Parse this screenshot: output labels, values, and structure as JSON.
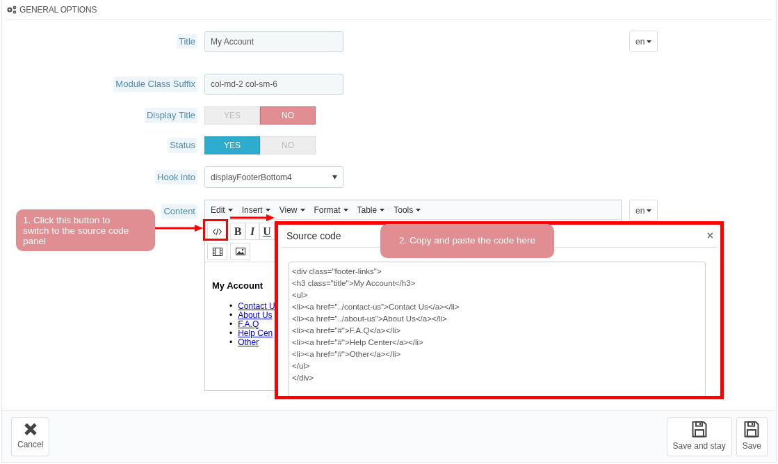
{
  "header": {
    "title": "GENERAL OPTIONS"
  },
  "fields": [
    {
      "kind": "text",
      "label": "Title",
      "value": "My Account",
      "lang": "en"
    },
    {
      "kind": "text",
      "label": "Module Class Suffix",
      "value": "col-md-2 col-sm-6"
    },
    {
      "kind": "switch",
      "label": "Display Title",
      "options": [
        {
          "label": "YES",
          "selected": false
        },
        {
          "label": "NO",
          "selected": true
        }
      ]
    },
    {
      "kind": "switch",
      "label": "Status",
      "options": [
        {
          "label": "YES",
          "selected": true
        },
        {
          "label": "NO",
          "selected": false
        }
      ]
    },
    {
      "kind": "select",
      "label": "Hook into",
      "value": "displayFooterBottom4"
    },
    {
      "kind": "editor",
      "label": "Content",
      "lang": "en",
      "menu": [
        "Edit",
        "Insert",
        "View",
        "Format",
        "Table",
        "Tools"
      ],
      "format_buttons": [
        "B",
        "I",
        "U"
      ],
      "preview": {
        "heading": "My Account",
        "bullet": "•",
        "links": [
          "Contact U",
          "About Us",
          "F.A.Q",
          "Help Cen",
          "Other"
        ]
      }
    }
  ],
  "modal": {
    "title": "Source code",
    "close": "×",
    "code": [
      "<div class=\"footer-links\">",
      "<h3 class=\"title\">My Account</h3>",
      "<ul>",
      "<li><a href=\"../contact-us\">Contact Us</a></li>",
      "<li><a href=\"../about-us\">About Us</a></li>",
      "<li><a href=\"#\">F.A.Q</a></li>",
      "<li><a href=\"#\">Help Center</a></li>",
      "<li><a href=\"#\">Other</a></li>",
      "</ul>",
      "</div>"
    ]
  },
  "callouts": [
    {
      "text": "1. Click this button to switch to the source code panel"
    },
    {
      "text": "2. Copy and paste the code here"
    }
  ],
  "footer": {
    "buttons": [
      {
        "kind": "cancel",
        "label": "Cancel"
      },
      {
        "kind": "save",
        "label": "Save and stay"
      },
      {
        "kind": "save",
        "label": "Save"
      }
    ]
  }
}
